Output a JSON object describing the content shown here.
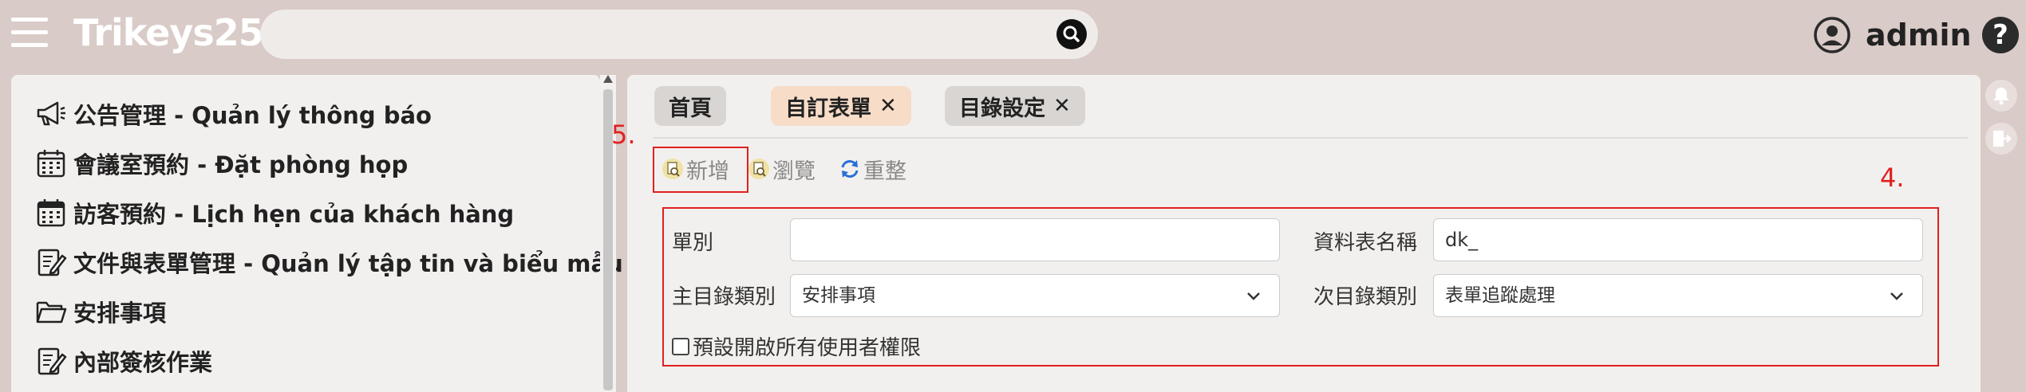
{
  "header": {
    "brand": "Trikeys25",
    "search_placeholder": "",
    "user_name": "admin",
    "help_label": "?"
  },
  "sidebar": {
    "items": [
      {
        "label": "公告管理 - Quản lý thông báo",
        "icon": "megaphone-icon"
      },
      {
        "label": "會議室預約 - Đặt phòng họp",
        "icon": "calendar-icon"
      },
      {
        "label": "訪客預約 - Lịch hẹn của khách hàng",
        "icon": "calendar-icon"
      },
      {
        "label": "文件與表單管理 - Quản lý tập tin và biểu mẫu",
        "icon": "edit-document-icon"
      },
      {
        "label": "安排事項",
        "icon": "folder-icon"
      },
      {
        "label": "內部簽核作業",
        "icon": "edit-document-icon"
      }
    ]
  },
  "tabs": [
    {
      "label": "首頁",
      "closable": false,
      "color": "#d9d5d2"
    },
    {
      "label": "自訂表單",
      "closable": true,
      "close": "✕",
      "color": "#f7dcc8"
    },
    {
      "label": "目錄設定",
      "closable": true,
      "close": "✕",
      "color": "#d9d5d2"
    }
  ],
  "annotations": {
    "step_5": "5.",
    "step_4": "4."
  },
  "toolbar": {
    "new_label": "新增",
    "browse_label": "瀏覽",
    "refresh_label": "重整"
  },
  "form": {
    "order_label": "單別",
    "order_value": "",
    "table_name_label": "資料表名稱",
    "table_name_value": "dk_",
    "main_category_label": "主目錄類別",
    "main_category_value": "安排事項",
    "sub_category_label": "次目錄類別",
    "sub_category_value": "表單追蹤處理",
    "default_permission_label": "預設開啟所有使用者權限",
    "default_permission_checked": false
  },
  "colors": {
    "background": "#d9cbc7",
    "panel": "#f2f0ee",
    "annotation_red": "#e02020",
    "refresh_blue": "#2a6fd6"
  }
}
